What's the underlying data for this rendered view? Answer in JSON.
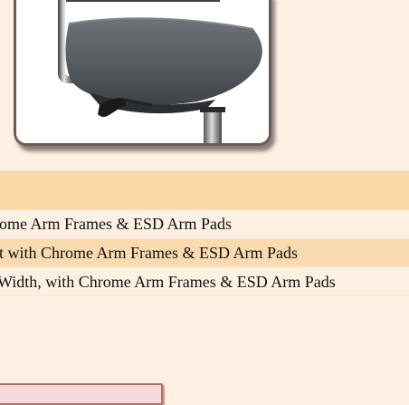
{
  "image": {
    "alt": ""
  },
  "table": {
    "rows": [
      {
        "text": "ome Arm Frames & ESD Arm Pads"
      },
      {
        "text": "t with Chrome Arm Frames & ESD Arm Pads"
      },
      {
        "text": "Width, with Chrome Arm Frames & ESD Arm Pads"
      }
    ]
  },
  "colors": {
    "page_background": "#fdf1e3",
    "header_bar": "#fbd9a6",
    "highlight_row": "#fadbb0",
    "button_fill": "#f6d9d9",
    "button_border": "#b06e64"
  }
}
